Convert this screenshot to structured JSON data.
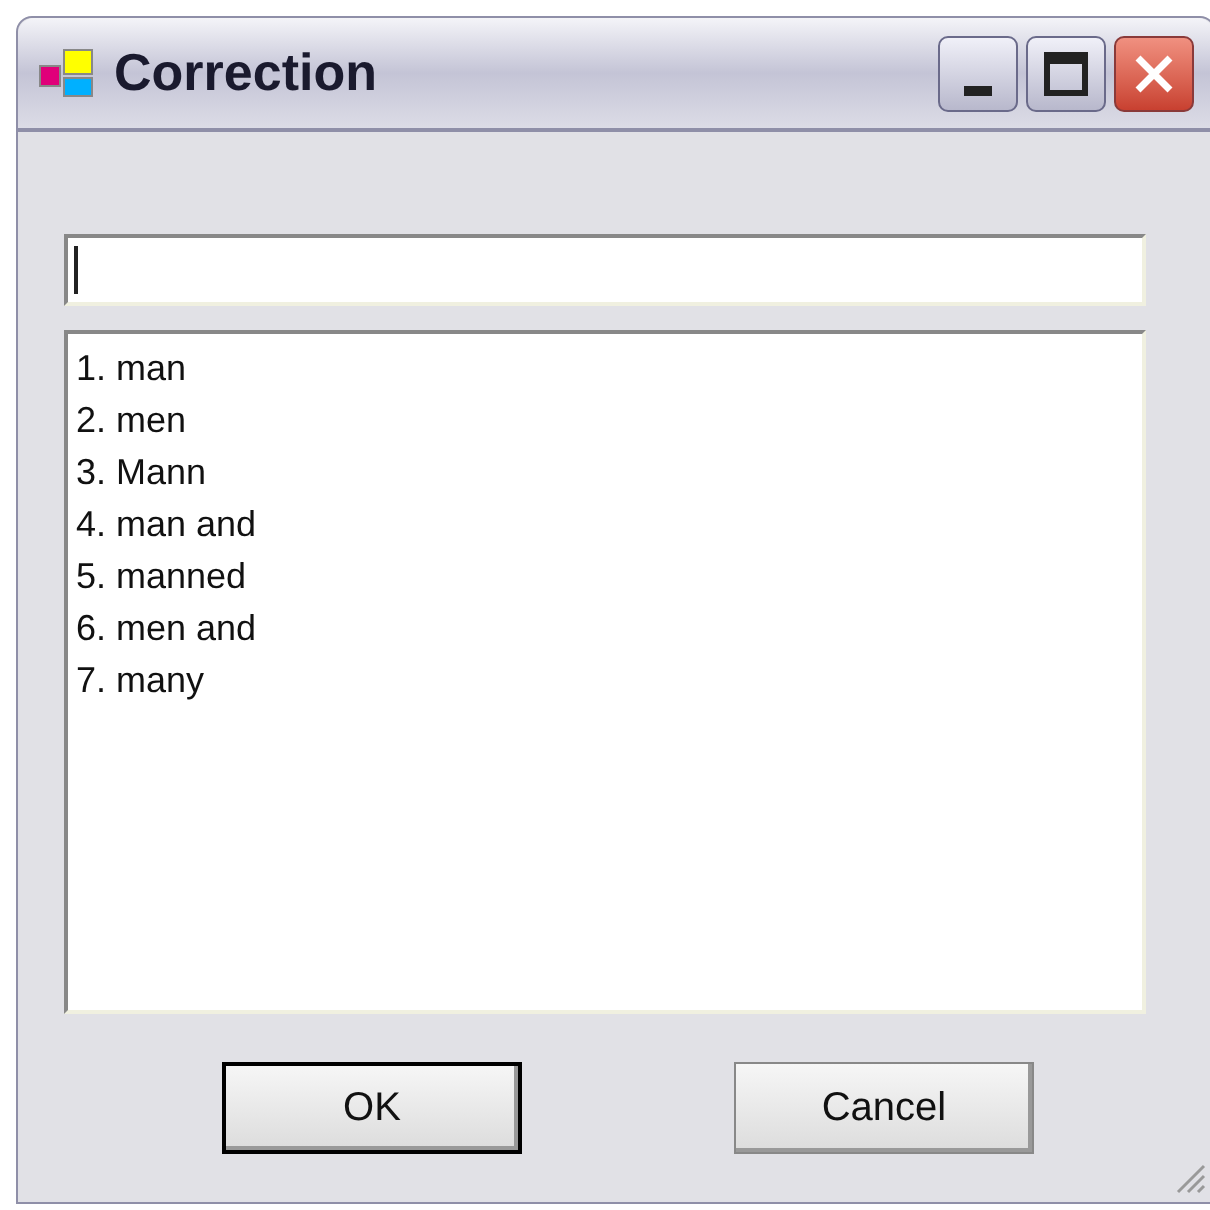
{
  "window": {
    "title": "Correction"
  },
  "suggestions": [
    "1. man",
    "2. men",
    "3. Mann",
    "4. man and",
    "5. manned",
    "6. men and",
    "7. many"
  ],
  "buttons": [
    {
      "label": "OK",
      "default": true
    },
    {
      "label": "Cancel",
      "default": false
    }
  ]
}
